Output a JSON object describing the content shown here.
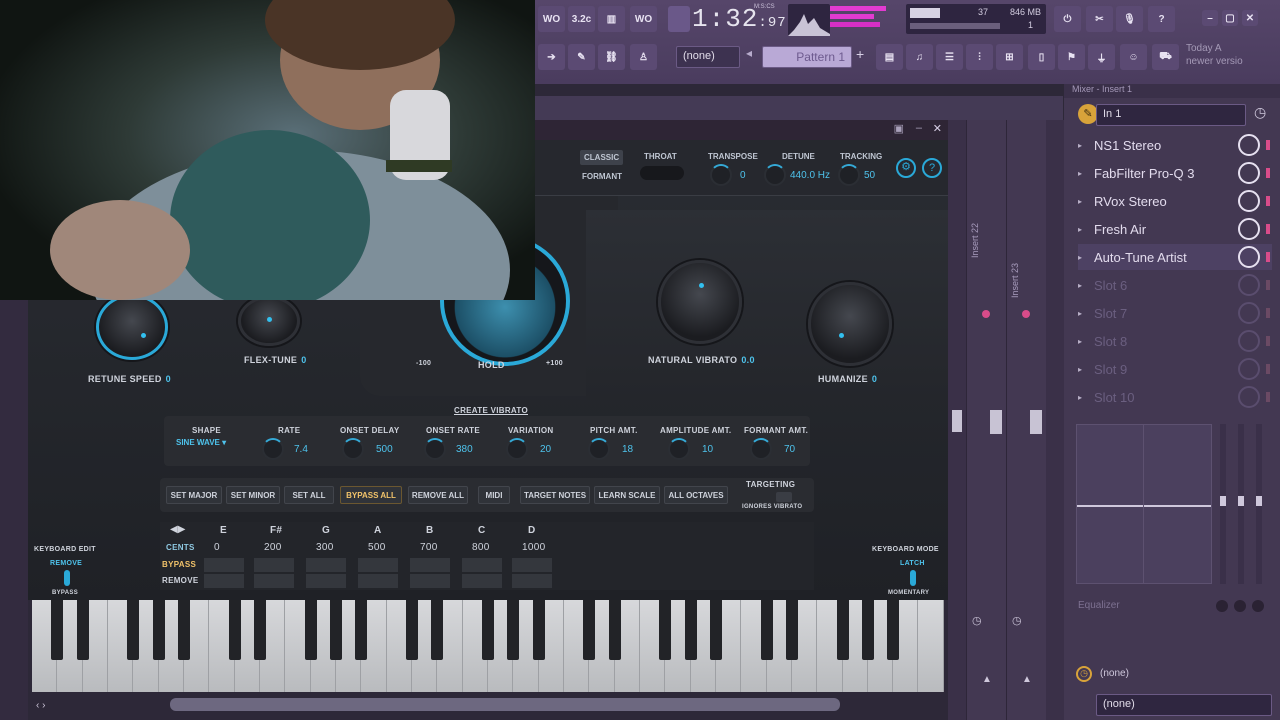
{
  "toolbar": {
    "time": "1:32",
    "time_sub": "97",
    "time_unit": "M:S:CS",
    "cpu_value": "37",
    "ram_value": "846 MB",
    "ram_sub": "1",
    "buttons": [
      "WO",
      "3.2c",
      "",
      "WO"
    ],
    "pattern_label": "Pattern 1",
    "none_select": "(none)",
    "hint_line1": "Today  A",
    "hint_line2": "newer versio"
  },
  "mixer": {
    "title": "Mixer - Insert 1",
    "input": "In 1",
    "slots": [
      {
        "name": "NS1 Stereo",
        "active": true
      },
      {
        "name": "FabFilter Pro-Q 3",
        "active": true
      },
      {
        "name": "RVox Stereo",
        "active": true
      },
      {
        "name": "Fresh Air",
        "active": true
      },
      {
        "name": "Auto-Tune Artist",
        "active": true
      },
      {
        "name": "Slot 6",
        "active": false
      },
      {
        "name": "Slot 7",
        "active": false
      },
      {
        "name": "Slot 8",
        "active": false
      },
      {
        "name": "Slot 9",
        "active": false
      },
      {
        "name": "Slot 10",
        "active": false
      }
    ],
    "track_labels": [
      "Insert 22",
      "Insert 23"
    ],
    "equalizer_label": "Equalizer",
    "out_none": "(none)",
    "out_none2": "(none)"
  },
  "plugin": {
    "mode_classic": "CLASSIC",
    "mode_formant": "FORMANT",
    "throat_label": "THROAT",
    "transpose_label": "TRANSPOSE",
    "transpose_value": "0",
    "detune_label": "DETUNE",
    "detune_value": "440.0 Hz",
    "tracking_label": "TRACKING",
    "tracking_value": "50",
    "retune_label": "RETUNE SPEED",
    "retune_value": "0",
    "flextune_label": "FLEX-TUNE",
    "flextune_value": "0",
    "hold_label": "HOLD",
    "pitch_min": "-100",
    "pitch_max": "+100",
    "vibrato_label": "NATURAL VIBRATO",
    "vibrato_value": "0.0",
    "humanize_label": "HUMANIZE",
    "humanize_value": "0",
    "create_vibrato": "CREATE VIBRATO",
    "shape_label": "SHAPE",
    "shape_value": "SINE WAVE",
    "rate_label": "RATE",
    "rate_value": "7.4",
    "onset_delay_label": "ONSET DELAY",
    "onset_delay_value": "500",
    "onset_rate_label": "ONSET RATE",
    "onset_rate_value": "380",
    "variation_label": "VARIATION",
    "variation_value": "20",
    "pitch_amt_label": "PITCH AMT.",
    "pitch_amt_value": "18",
    "amp_amt_label": "AMPLITUDE AMT.",
    "amp_amt_value": "10",
    "formant_amt_label": "FORMANT AMT.",
    "formant_amt_value": "70",
    "scale_buttons": [
      "SET MAJOR",
      "SET MINOR",
      "SET ALL",
      "BYPASS ALL",
      "REMOVE ALL",
      "MIDI",
      "TARGET NOTES",
      "LEARN SCALE",
      "ALL OCTAVES"
    ],
    "targeting_label": "TARGETING",
    "targeting_sub": "IGNORES VIBRATO",
    "notes": [
      "E",
      "F#",
      "G",
      "A",
      "B",
      "C",
      "D"
    ],
    "cents_label": "CENTS",
    "cents": [
      "0",
      "200",
      "300",
      "500",
      "700",
      "800",
      "1000"
    ],
    "bypass_label": "BYPASS",
    "remove_label": "REMOVE",
    "kb_edit_label": "KEYBOARD EDIT",
    "kb_edit_remove": "REMOVE",
    "kb_edit_bypass": "BYPASS",
    "kb_mode_label": "KEYBOARD MODE",
    "kb_mode_latch": "LATCH",
    "kb_mode_momentary": "MOMENTARY"
  },
  "colors": {
    "accent_blue": "#2aa9d8",
    "fl_purple": "#4a3c5e",
    "peak_pink": "#e23bd1"
  }
}
